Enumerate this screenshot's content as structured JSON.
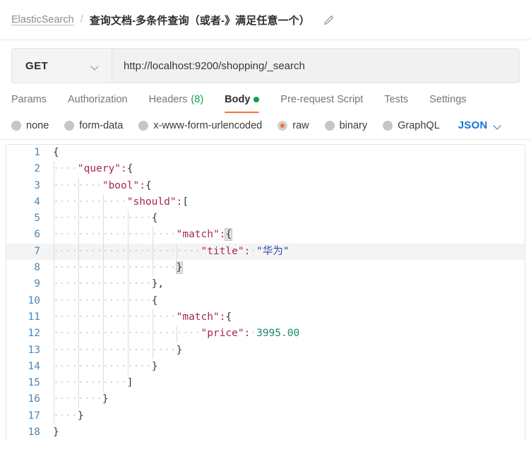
{
  "breadcrumb": {
    "root": "ElasticSearch",
    "separator": "/",
    "title": "查询文档-多条件查询（或者-》满足任意一个）",
    "edit_icon": "pencil-icon"
  },
  "request": {
    "method": "GET",
    "method_chevron": "chevron-down-icon",
    "url": "http://localhost:9200/shopping/_search"
  },
  "tabs": [
    {
      "label": "Params",
      "active": false
    },
    {
      "label": "Authorization",
      "active": false
    },
    {
      "label": "Headers",
      "count": "(8)",
      "active": false
    },
    {
      "label": "Body",
      "active": true,
      "dot": "green-dot-icon"
    },
    {
      "label": "Pre-request Script",
      "active": false
    },
    {
      "label": "Tests",
      "active": false
    },
    {
      "label": "Settings",
      "active": false
    }
  ],
  "body_types": [
    {
      "label": "none",
      "selected": false
    },
    {
      "label": "form-data",
      "selected": false
    },
    {
      "label": "x-www-form-urlencoded",
      "selected": false
    },
    {
      "label": "raw",
      "selected": true
    },
    {
      "label": "binary",
      "selected": false
    },
    {
      "label": "GraphQL",
      "selected": false
    }
  ],
  "format_select": {
    "label": "JSON",
    "chevron": "chevron-down-icon"
  },
  "editor": {
    "active_line": 7,
    "lines": [
      {
        "n": "1",
        "text": "{"
      },
      {
        "n": "2",
        "text": "    \"query\":{"
      },
      {
        "n": "3",
        "text": "        \"bool\":{"
      },
      {
        "n": "4",
        "text": "            \"should\":["
      },
      {
        "n": "5",
        "text": "                {"
      },
      {
        "n": "6",
        "text": "                    \"match\":{"
      },
      {
        "n": "7",
        "text": "                        \"title\": \"华为\""
      },
      {
        "n": "8",
        "text": "                    }"
      },
      {
        "n": "9",
        "text": "                },"
      },
      {
        "n": "10",
        "text": "                {"
      },
      {
        "n": "11",
        "text": "                    \"match\":{"
      },
      {
        "n": "12",
        "text": "                        \"price\": 3995.00"
      },
      {
        "n": "13",
        "text": "                    }"
      },
      {
        "n": "14",
        "text": "                }"
      },
      {
        "n": "15",
        "text": "            ]"
      },
      {
        "n": "16",
        "text": "        }"
      },
      {
        "n": "17",
        "text": "    }"
      },
      {
        "n": "18",
        "text": "}"
      }
    ]
  },
  "colors": {
    "accent_orange": "#ff6c37",
    "status_green": "#0ea04a",
    "link_blue": "#1a73d4",
    "json_key": "#a52a45",
    "json_string": "#2d4ea8",
    "json_number": "#1a8a72",
    "line_number": "#4d87b5"
  }
}
